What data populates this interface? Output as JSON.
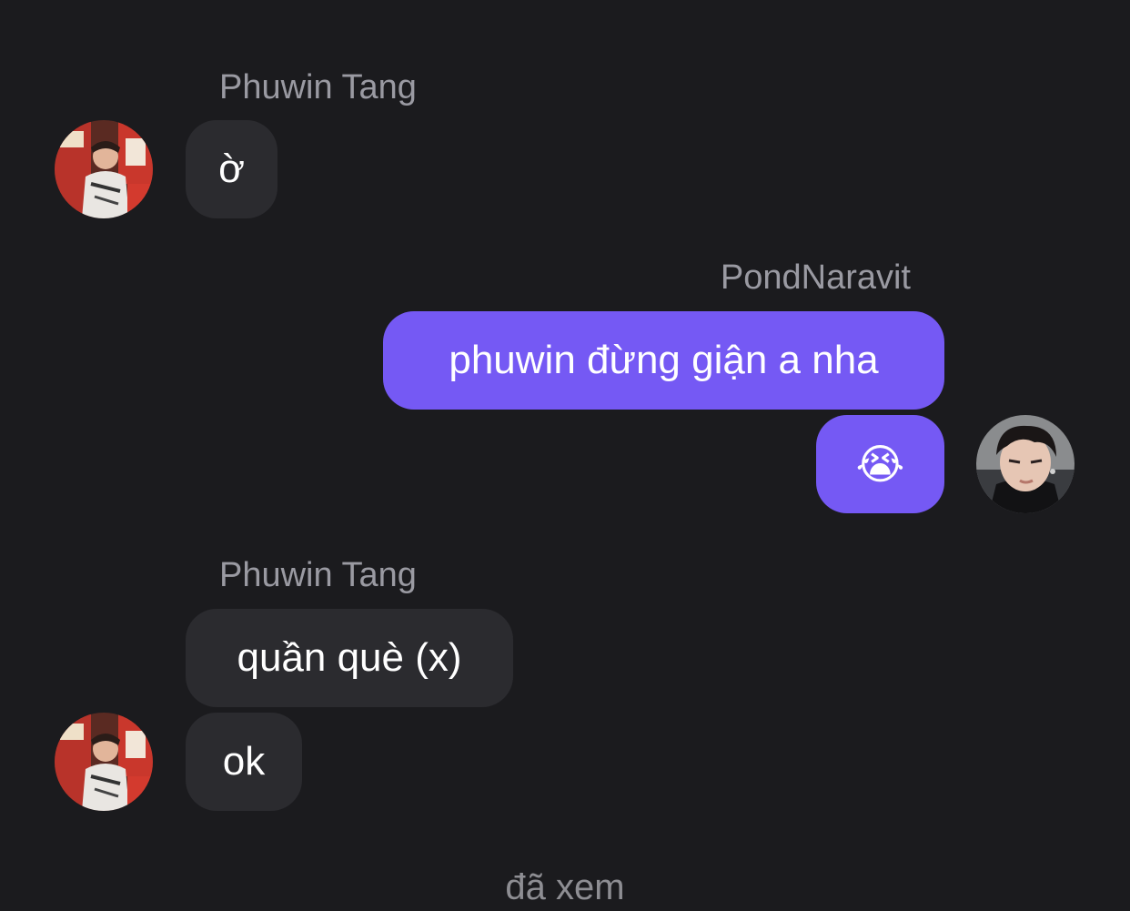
{
  "conversation": {
    "groups": [
      {
        "sender": "Phuwin Tang",
        "messages": [
          "ờ"
        ]
      },
      {
        "sender": "PondNaravit",
        "messages": [
          "phuwin đừng giận a nha",
          "😭"
        ]
      },
      {
        "sender": "Phuwin Tang",
        "messages": [
          "quần què (x)",
          "ok"
        ]
      }
    ],
    "read_receipt": "đã xem"
  },
  "colors": {
    "background": "#1b1b1e",
    "incoming_bubble": "#2b2b2f",
    "outgoing_bubble": "#7559f4",
    "sender_name": "#9a9aa2",
    "read_receipt": "#8e8e93"
  },
  "icons": {
    "contact_avatar": "phuwin-avatar-photo",
    "own_avatar": "pond-avatar-photo",
    "loudly_crying_emoji": "crying-face-emoji"
  }
}
